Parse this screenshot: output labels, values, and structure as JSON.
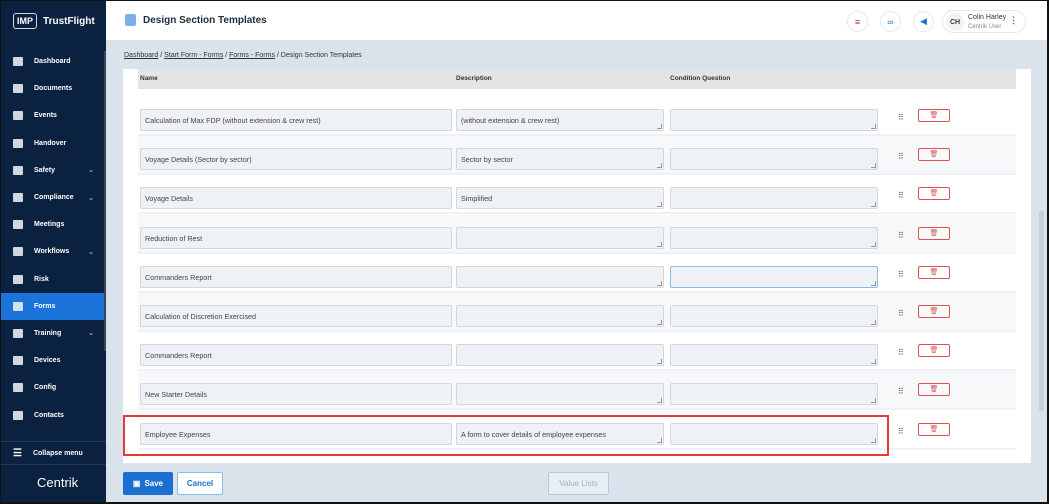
{
  "brand": {
    "logo_mark": "IMP",
    "name": "TrustFlight",
    "footer_logo": "Centrik"
  },
  "sidebar": {
    "items": [
      {
        "label": "Dashboard",
        "icon": "dashboard-icon"
      },
      {
        "label": "Documents",
        "icon": "paperclip-icon"
      },
      {
        "label": "Events",
        "icon": "megaphone-icon"
      },
      {
        "label": "Handover",
        "icon": "handover-icon"
      },
      {
        "label": "Safety",
        "icon": "shield-icon",
        "chevron": true
      },
      {
        "label": "Compliance",
        "icon": "compliance-icon",
        "chevron": true
      },
      {
        "label": "Meetings",
        "icon": "meetings-icon"
      },
      {
        "label": "Workflows",
        "icon": "workflows-icon",
        "chevron": true
      },
      {
        "label": "Risk",
        "icon": "risk-icon"
      },
      {
        "label": "Forms",
        "icon": "forms-icon",
        "active": true
      },
      {
        "label": "Training",
        "icon": "training-icon",
        "chevron": true
      },
      {
        "label": "Devices",
        "icon": "devices-icon"
      },
      {
        "label": "Config",
        "icon": "config-icon"
      },
      {
        "label": "Contacts",
        "icon": "contacts-icon"
      }
    ],
    "collapse_label": "Collapse menu"
  },
  "header": {
    "title": "Design Section Templates",
    "user": {
      "initials": "CH",
      "name": "Colin Harley",
      "role": "Centrik User"
    }
  },
  "breadcrumb": {
    "links": [
      "Dashboard",
      "Start Form - Forms",
      "Forms - Forms"
    ],
    "current": "Design Section Templates",
    "sep": " / "
  },
  "table": {
    "columns": [
      "Name",
      "Description",
      "Condition Question"
    ],
    "rows": [
      {
        "name": "Calculation of Max FDP (without extension & crew rest)",
        "description": "(without extension & crew rest)",
        "condition": ""
      },
      {
        "name": "Voyage Details (Sector by sector)",
        "description": "Sector by sector",
        "condition": ""
      },
      {
        "name": "Voyage Details",
        "description": "Simplified",
        "condition": ""
      },
      {
        "name": "Reduction of Rest",
        "description": "",
        "condition": ""
      },
      {
        "name": "Commanders Report",
        "description": "",
        "condition": ""
      },
      {
        "name": "Calculation of Discretion Exercised",
        "description": "",
        "condition": ""
      },
      {
        "name": "Commanders Report",
        "description": "",
        "condition": ""
      },
      {
        "name": "New Starter Details",
        "description": "",
        "condition": ""
      },
      {
        "name": "Employee Expenses",
        "description": "A form to cover details of employee expenses",
        "condition": ""
      }
    ]
  },
  "footer": {
    "save": "Save",
    "cancel": "Cancel",
    "value_lists": "Value Lists"
  },
  "colors": {
    "sidebar": "#0b2140",
    "accent": "#1a73d9",
    "danger": "#d9534f",
    "highlight": "#e53935"
  }
}
